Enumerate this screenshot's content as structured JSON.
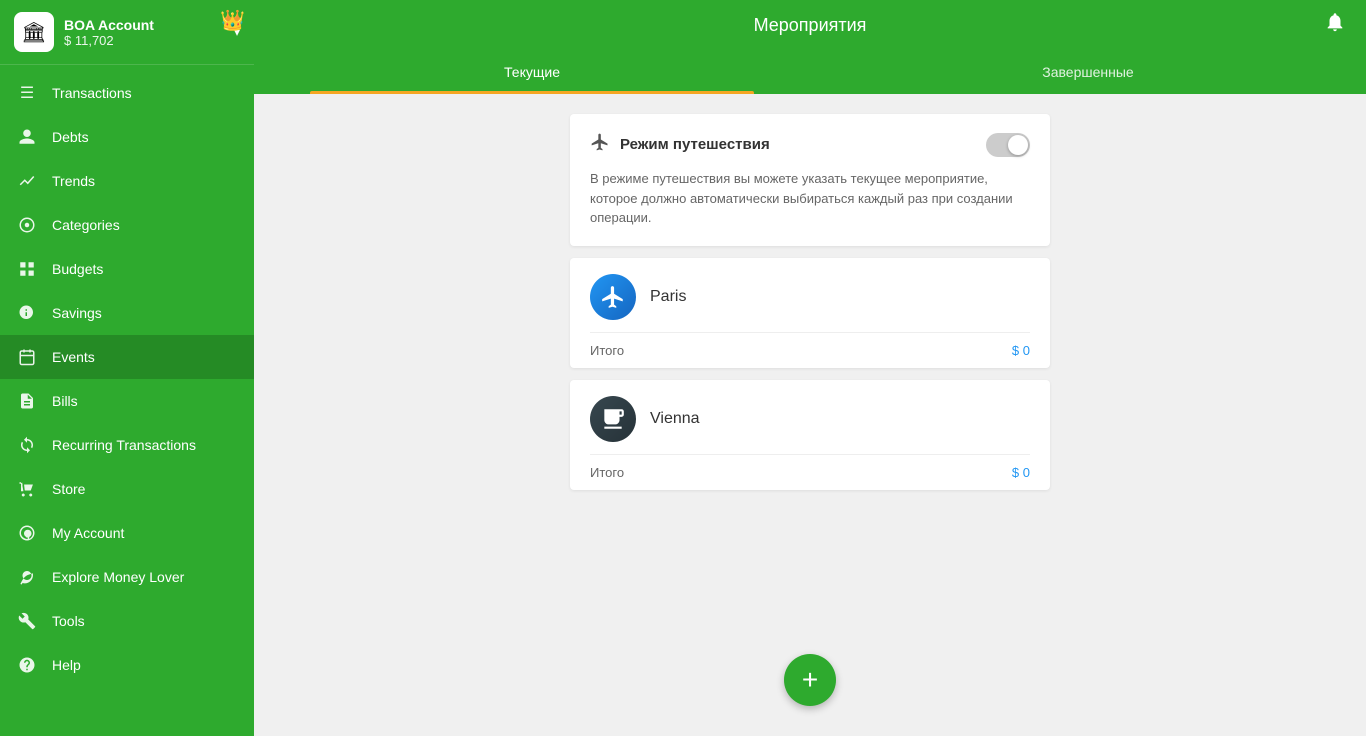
{
  "app": {
    "logo": "🏛",
    "crown": "👑"
  },
  "account": {
    "name": "BOA Account",
    "balance": "$ 11,702",
    "dropdown_arrow": "▾"
  },
  "sidebar": {
    "items": [
      {
        "id": "transactions",
        "label": "Transactions",
        "icon": "📋"
      },
      {
        "id": "debts",
        "label": "Debts",
        "icon": "👤"
      },
      {
        "id": "trends",
        "label": "Trends",
        "icon": "📈"
      },
      {
        "id": "categories",
        "label": "Categories",
        "icon": "🏷"
      },
      {
        "id": "budgets",
        "label": "Budgets",
        "icon": "📊"
      },
      {
        "id": "savings",
        "label": "Savings",
        "icon": "💰"
      },
      {
        "id": "events",
        "label": "Events",
        "icon": "📅"
      },
      {
        "id": "bills",
        "label": "Bills",
        "icon": "🗒"
      },
      {
        "id": "recurring",
        "label": "Recurring Transactions",
        "icon": "🔄"
      },
      {
        "id": "store",
        "label": "Store",
        "icon": "🛒"
      },
      {
        "id": "my-account",
        "label": "My Account",
        "icon": "☁"
      },
      {
        "id": "explore",
        "label": "Explore Money Lover",
        "icon": "🌿"
      },
      {
        "id": "tools",
        "label": "Tools",
        "icon": "✂"
      },
      {
        "id": "help",
        "label": "Help",
        "icon": "❓"
      }
    ]
  },
  "header": {
    "title": "Мероприятия",
    "bell_icon": "🔔"
  },
  "tabs": [
    {
      "id": "current",
      "label": "Текущие",
      "active": true
    },
    {
      "id": "completed",
      "label": "Завершенные",
      "active": false
    }
  ],
  "travel_mode": {
    "title": "Режим путешествия",
    "description": "В режиме путешествия вы можете указать текущее мероприятие, которое должно автоматически выбираться каждый раз при создании операции.",
    "enabled": false
  },
  "events": [
    {
      "id": "paris",
      "name": "Paris",
      "emoji": "✈",
      "total_label": "Итого",
      "total_value": "$ 0",
      "bg": "paris"
    },
    {
      "id": "vienna",
      "name": "Vienna",
      "emoji": "🍸",
      "total_label": "Итого",
      "total_value": "$ 0",
      "bg": "vienna"
    }
  ],
  "fab": {
    "label": "+"
  }
}
